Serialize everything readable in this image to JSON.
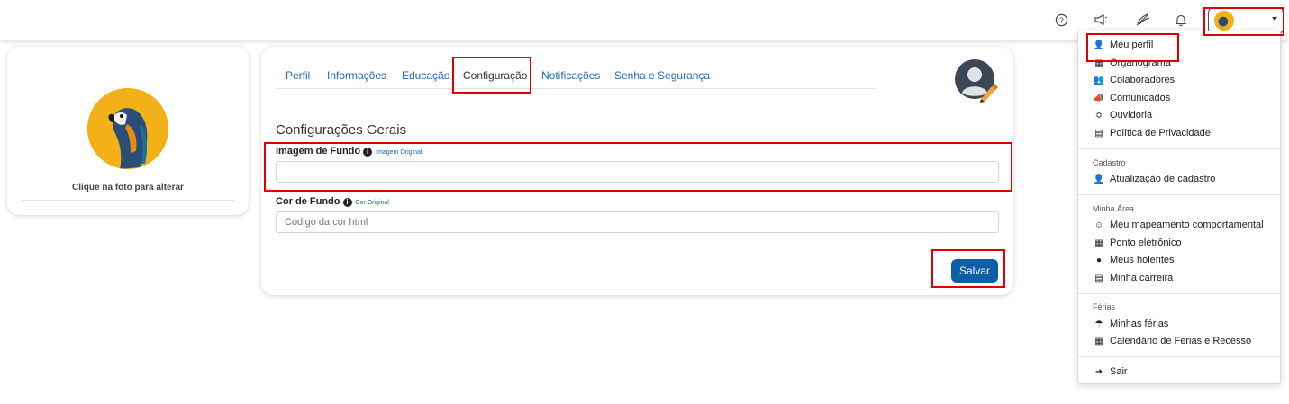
{
  "topbar": {
    "icons": [
      "help-icon",
      "megaphone-icon",
      "ouvidoria-icon",
      "bell-icon"
    ],
    "user_menu_caret": "chevron-down-icon"
  },
  "left_card": {
    "caption": "Clique na foto para alterar"
  },
  "tabs": [
    {
      "label": "Perfil"
    },
    {
      "label": "Informações"
    },
    {
      "label": "Educação"
    },
    {
      "label": "Configuração",
      "active": true
    },
    {
      "label": "Notificações"
    },
    {
      "label": "Senha e Segurança"
    }
  ],
  "settings": {
    "section_title": "Configurações Gerais",
    "bg_image": {
      "label": "Imagem de Fundo",
      "link": "Imagem Original",
      "value": ""
    },
    "bg_color": {
      "label": "Cor de Fundo",
      "link": "Cor Original",
      "placeholder": "Código da cor html"
    },
    "save_label": "Salvar"
  },
  "dropdown": {
    "main": [
      {
        "label": "Meu perfil",
        "icon": "user-icon"
      },
      {
        "label": "Organograma",
        "icon": "sitemap-icon"
      },
      {
        "label": "Colaboradores",
        "icon": "users-icon"
      },
      {
        "label": "Comunicados",
        "icon": "megaphone-icon"
      },
      {
        "label": "Ouvidoria",
        "icon": "ouvidoria-icon"
      },
      {
        "label": "Política de Privacidade",
        "icon": "document-icon"
      }
    ],
    "cadastro_header": "Cadastro",
    "cadastro": [
      {
        "label": "Atualização de cadastro",
        "icon": "user-icon"
      }
    ],
    "minha_area_header": "Minha Área",
    "minha_area": [
      {
        "label": "Meu mapeamento comportamental",
        "icon": "brain-icon"
      },
      {
        "label": "Ponto eletrônico",
        "icon": "id-card-icon"
      },
      {
        "label": "Meus holerites",
        "icon": "money-icon"
      },
      {
        "label": "Minha carreira",
        "icon": "briefcase-icon"
      }
    ],
    "ferias_header": "Férias",
    "ferias": [
      {
        "label": "Minhas férias",
        "icon": "umbrella-beach-icon"
      },
      {
        "label": "Calendário de Férias e Recesso",
        "icon": "calendar-icon"
      }
    ],
    "logout": {
      "label": "Sair",
      "icon": "sign-out-icon"
    }
  },
  "colors": {
    "accent": "#1e6bb8",
    "button": "#0f5ea8",
    "highlight": "#e00000"
  }
}
